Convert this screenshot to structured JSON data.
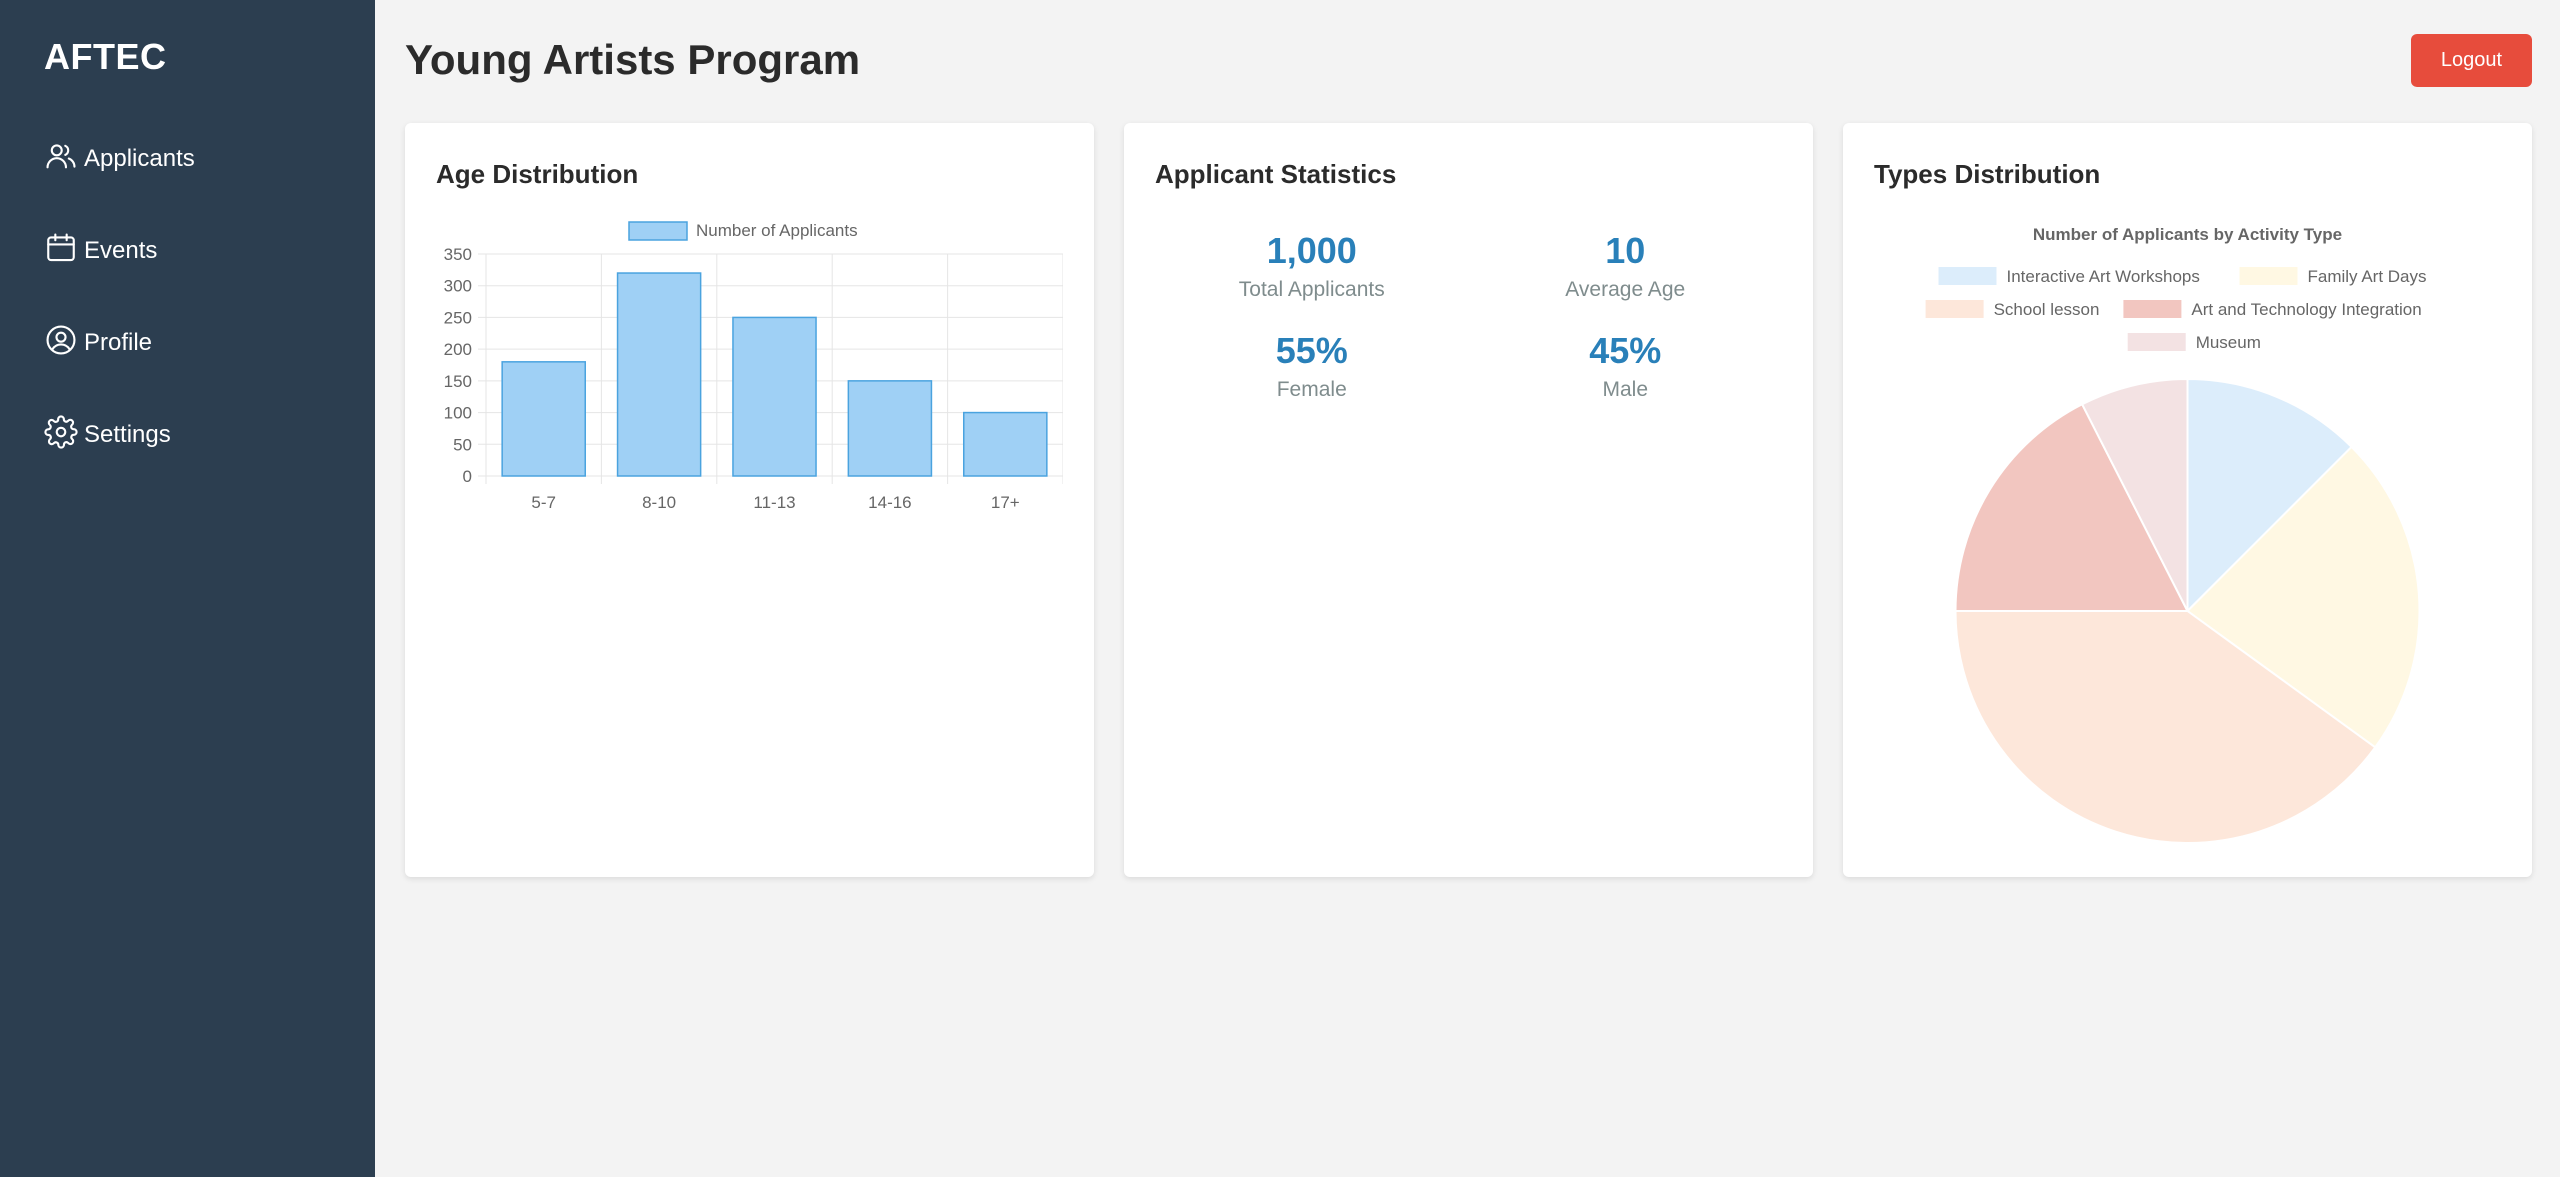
{
  "sidebar": {
    "brand": "AFTEC",
    "items": [
      {
        "label": "Applicants",
        "icon": "users-icon"
      },
      {
        "label": "Events",
        "icon": "calendar-icon"
      },
      {
        "label": "Profile",
        "icon": "user-circle-icon"
      },
      {
        "label": "Settings",
        "icon": "gear-icon"
      }
    ]
  },
  "header": {
    "title": "Young Artists Program",
    "logout_label": "Logout"
  },
  "colors": {
    "sidebar_bg": "#2c3e50",
    "accent": "#2980b9",
    "logout": "#e74c3c"
  },
  "age_card": {
    "title": "Age Distribution"
  },
  "stats_card": {
    "title": "Applicant Statistics",
    "stats": [
      {
        "value": "1,000",
        "label": "Total Applicants"
      },
      {
        "value": "10",
        "label": "Average Age"
      },
      {
        "value": "55%",
        "label": "Female"
      },
      {
        "value": "45%",
        "label": "Male"
      }
    ]
  },
  "types_card": {
    "title": "Types Distribution"
  },
  "chart_data": [
    {
      "type": "bar",
      "categories": [
        "5-7",
        "8-10",
        "11-13",
        "14-16",
        "17+"
      ],
      "series": [
        {
          "name": "Number of Applicants",
          "values": [
            180,
            320,
            250,
            150,
            100
          ]
        }
      ],
      "yticks": [
        0,
        50,
        100,
        150,
        200,
        250,
        300,
        350
      ],
      "ylim": [
        0,
        350
      ],
      "grid": true,
      "legend": "top",
      "bar_fill": "#9fd0f5",
      "bar_stroke": "#4aa3df"
    },
    {
      "type": "pie",
      "title": "Number of Applicants by Activity Type",
      "legend": "top",
      "slices": [
        {
          "label": "Interactive Art Workshops",
          "value": 12.5,
          "color": "#dcedfb"
        },
        {
          "label": "Family Art Days",
          "value": 22.5,
          "color": "#fff8e3"
        },
        {
          "label": "School lesson",
          "value": 40,
          "color": "#fde7da"
        },
        {
          "label": "Art and Technology Integration",
          "value": 17.5,
          "color": "#f2c6c0"
        },
        {
          "label": "Museum",
          "value": 7.5,
          "color": "#f3e2e3"
        }
      ]
    }
  ]
}
